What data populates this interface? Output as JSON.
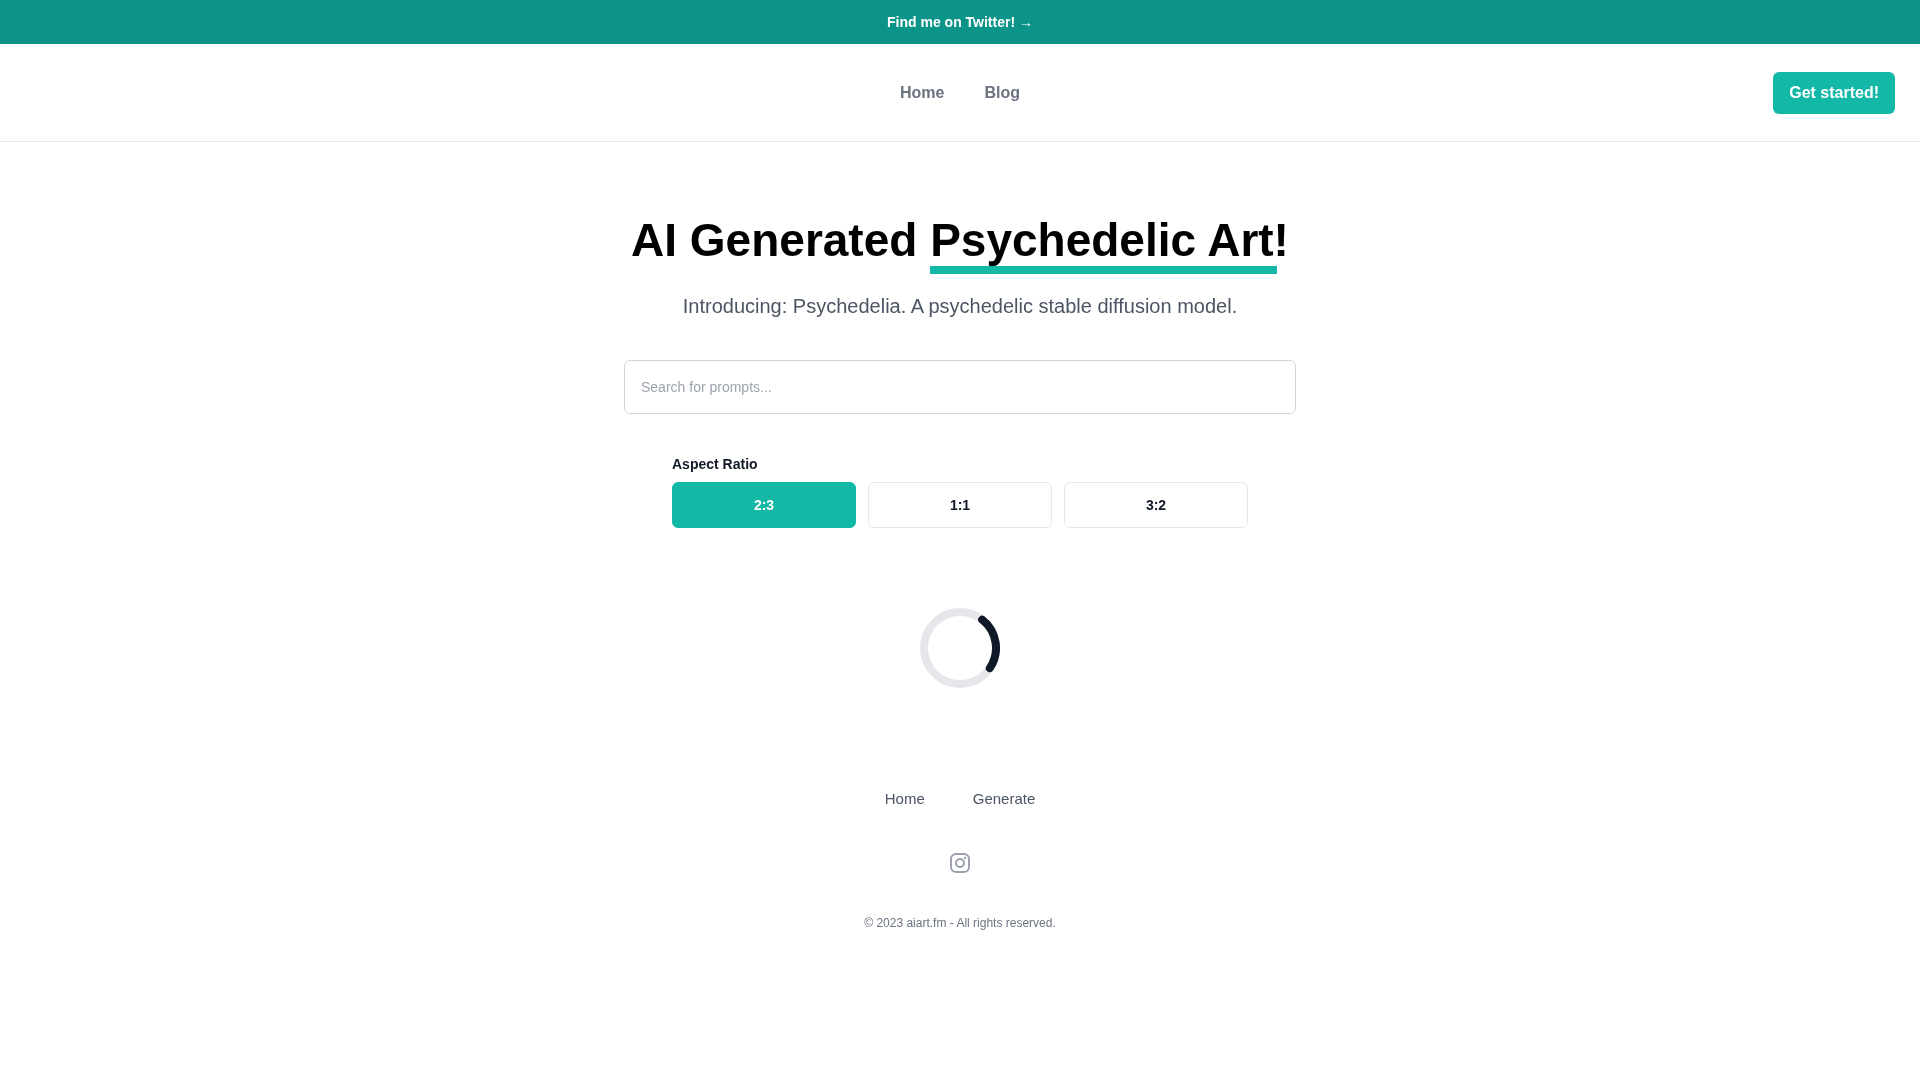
{
  "banner": {
    "text": "Find me on Twitter! →"
  },
  "nav": {
    "links": [
      {
        "label": "Home"
      },
      {
        "label": "Blog"
      }
    ],
    "cta": "Get started!"
  },
  "hero": {
    "title": "AI Generated",
    "title_highlight": "Psychedelic Art!",
    "subtitle": "Introducing: Psychedelia. A psychedelic stable diffusion model."
  },
  "search": {
    "placeholder": "Search for prompts..."
  },
  "aspect_ratio": {
    "label": "Aspect Ratio",
    "options": [
      {
        "label": "2:3",
        "selected": true
      },
      {
        "label": "1:1",
        "selected": false
      },
      {
        "label": "3:2",
        "selected": false
      }
    ]
  },
  "loading": true,
  "footer": {
    "links": [
      {
        "label": "Home"
      },
      {
        "label": "Generate"
      }
    ],
    "copyright": "© 2023 aiart.fm - All rights reserved."
  }
}
